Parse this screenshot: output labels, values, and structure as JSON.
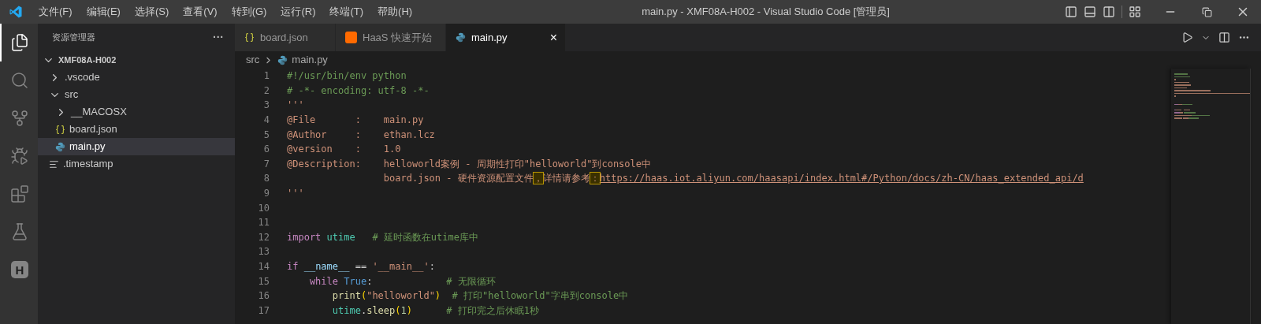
{
  "window": {
    "title": "main.py - XMF08A-H002 - Visual Studio Code [管理员]"
  },
  "menu": [
    "文件(F)",
    "编辑(E)",
    "选择(S)",
    "查看(V)",
    "转到(G)",
    "运行(R)",
    "终端(T)",
    "帮助(H)"
  ],
  "activity_bar": [
    {
      "kind": "explorer",
      "selected": true
    },
    {
      "kind": "search",
      "selected": false
    },
    {
      "kind": "source-control",
      "selected": false
    },
    {
      "kind": "run-debug",
      "selected": false
    },
    {
      "kind": "extensions",
      "selected": false
    },
    {
      "kind": "testing",
      "selected": false
    },
    {
      "kind": "haas",
      "glyph": "H",
      "selected": false
    }
  ],
  "sidebar": {
    "title": "资源管理器",
    "more": "···",
    "tree": [
      {
        "label": "XMF08A-H002",
        "kind": "root",
        "expanded": true,
        "selected": false,
        "children": [
          {
            "label": ".vscode",
            "kind": "folder",
            "expanded": false,
            "selected": false
          },
          {
            "label": "src",
            "kind": "folder",
            "expanded": true,
            "selected": false,
            "children": [
              {
                "label": "__MACOSX",
                "kind": "folder",
                "expanded": false,
                "selected": false
              },
              {
                "label": "board.json",
                "kind": "json",
                "selected": false
              },
              {
                "label": "main.py",
                "kind": "python",
                "selected": true
              }
            ]
          },
          {
            "label": ".timestamp",
            "kind": "text",
            "selected": false
          }
        ]
      }
    ]
  },
  "tabs": [
    {
      "label": "board.json",
      "kind": "json",
      "selected": false
    },
    {
      "label": "HaaS 快速开始",
      "kind": "haas",
      "selected": false
    },
    {
      "label": "main.py",
      "kind": "python",
      "selected": true,
      "close": "×"
    }
  ],
  "breadcrumb": [
    {
      "label": "src",
      "kind": "folder"
    },
    {
      "label": "main.py",
      "kind": "python"
    }
  ],
  "code": [
    {
      "number": "1",
      "tokens": [
        {
          "text": "#!/usr/bin/env python",
          "kind": "comment"
        }
      ]
    },
    {
      "number": "2",
      "tokens": [
        {
          "text": "# -*- encoding: utf-8 -*-",
          "kind": "comment"
        }
      ]
    },
    {
      "number": "3",
      "tokens": [
        {
          "text": "'''",
          "kind": "string"
        }
      ]
    },
    {
      "number": "4",
      "tokens": [
        {
          "text": "@File       :    main.py",
          "kind": "string"
        }
      ]
    },
    {
      "number": "5",
      "tokens": [
        {
          "text": "@Author     :    ethan.lcz",
          "kind": "string"
        }
      ]
    },
    {
      "number": "6",
      "tokens": [
        {
          "text": "@version    :    1.0",
          "kind": "string"
        }
      ]
    },
    {
      "number": "7",
      "tokens": [
        {
          "text": "@Description:    helloworld案例 - 周期性打印\"helloworld\"到console中",
          "kind": "string"
        }
      ]
    },
    {
      "number": "8",
      "tokens": [
        {
          "text": "                 board.json - 硬件资源配置文件",
          "kind": "string"
        },
        {
          "text": "，",
          "kind": "highlight"
        },
        {
          "text": "详情请参考",
          "kind": "string"
        },
        {
          "text": "：",
          "kind": "highlight"
        },
        {
          "text": "https://haas.iot.aliyun.com/haasapi/index.html#/Python/docs/zh-CN/haas_extended_api/d",
          "kind": "link"
        }
      ]
    },
    {
      "number": "9",
      "tokens": [
        {
          "text": "'''",
          "kind": "string"
        }
      ]
    },
    {
      "number": "10"
    },
    {
      "number": "11"
    },
    {
      "number": "12",
      "tokens": [
        {
          "text": "import",
          "kind": "keyword"
        },
        {
          "text": " utime",
          "kind": "module"
        },
        {
          "text": "   # 延时函数在utime库中",
          "kind": "comment"
        }
      ]
    },
    {
      "number": "13"
    },
    {
      "number": "14",
      "tokens": [
        {
          "text": "if",
          "kind": "keyword"
        },
        {
          "text": " __name__",
          "kind": "variable"
        },
        {
          "text": " == ",
          "kind": "plain"
        },
        {
          "text": "'__main__'",
          "kind": "string"
        },
        {
          "text": ":",
          "kind": "plain"
        }
      ]
    },
    {
      "number": "15",
      "tokens": [
        {
          "text": "    while",
          "kind": "keyword"
        },
        {
          "text": " True",
          "kind": "constant"
        },
        {
          "text": ":",
          "kind": "plain"
        },
        {
          "text": "             # 无限循环",
          "kind": "comment"
        }
      ]
    },
    {
      "number": "16",
      "tokens": [
        {
          "text": "        print",
          "kind": "function"
        },
        {
          "text": "(",
          "kind": "bracket"
        },
        {
          "text": "\"helloworld\"",
          "kind": "string"
        },
        {
          "text": ")",
          "kind": "bracket"
        },
        {
          "text": "  # 打印\"helloworld\"字串到console中",
          "kind": "comment"
        }
      ]
    },
    {
      "number": "17",
      "tokens": [
        {
          "text": "        utime",
          "kind": "module"
        },
        {
          "text": ".",
          "kind": "plain"
        },
        {
          "text": "sleep",
          "kind": "function"
        },
        {
          "text": "(",
          "kind": "bracket"
        },
        {
          "text": "1",
          "kind": "number"
        },
        {
          "text": ")",
          "kind": "bracket"
        },
        {
          "text": "      # 打印完之后休眠1秒",
          "kind": "comment"
        }
      ]
    }
  ]
}
